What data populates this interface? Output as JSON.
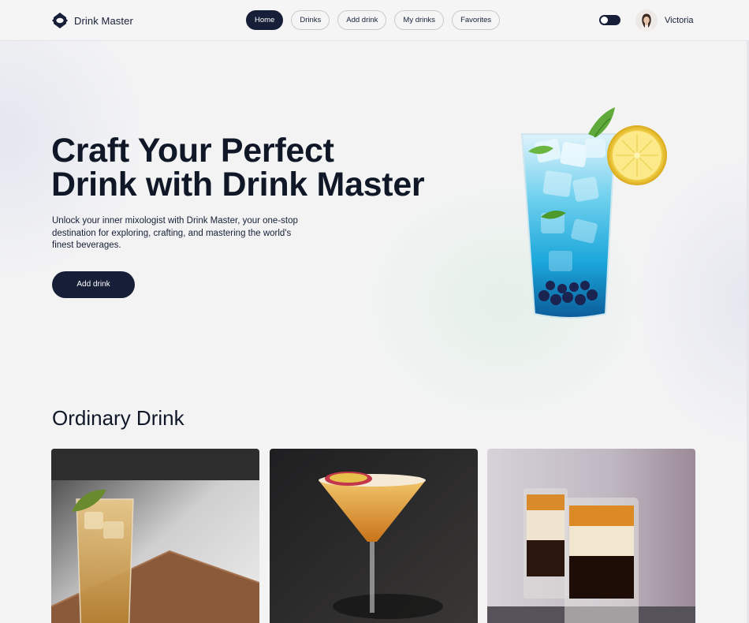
{
  "app": {
    "name": "Drink Master",
    "logo_icon": "diamond-logo-icon"
  },
  "nav": {
    "items": [
      {
        "label": "Home",
        "active": true
      },
      {
        "label": "Drinks",
        "active": false
      },
      {
        "label": "Add drink",
        "active": false
      },
      {
        "label": "My drinks",
        "active": false
      },
      {
        "label": "Favorites",
        "active": false
      }
    ]
  },
  "theme_toggle": {
    "icon": "toggle-switch-icon",
    "state": "dark"
  },
  "user": {
    "name": "Victoria"
  },
  "hero": {
    "title_line1": "Craft Your Perfect",
    "title_line2": "Drink with Drink Master",
    "description": "Unlock your inner mixologist with Drink Master, your one-stop destination for exploring, crafting, and mastering the world's finest beverages.",
    "cta_label": "Add drink"
  },
  "section": {
    "title": "Ordinary Drink"
  },
  "colors": {
    "primary": "#161f37",
    "background": "#f3f3f4",
    "text": "#101828"
  }
}
